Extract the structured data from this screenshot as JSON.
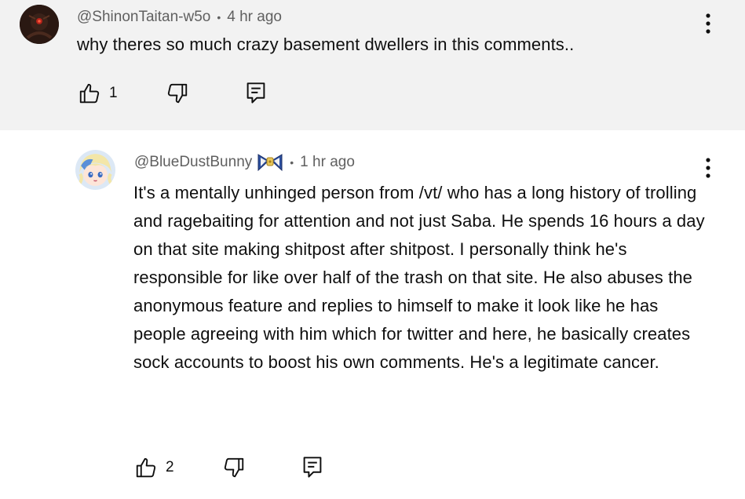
{
  "comments": [
    {
      "author": "@ShinonTaitan-w5o",
      "separator": "•",
      "time": "4 hr ago",
      "text": "why theres so much crazy basement dwellers in this comments..",
      "likes": "1",
      "avatar_icon": "dark-robot-avatar"
    },
    {
      "author": "@BlueDustBunny",
      "separator": "•",
      "time": "1 hr ago",
      "text": "It's a mentally unhinged person from /vt/ who has a long history of trolling and ragebaiting for attention and not just Saba. He spends 16 hours a day on that site making shitpost after shitpost. I personally think he's responsible for like over half of the trash on that site. He also abuses the anonymous feature and replies to himself to make it look like he has people agreeing with him which for twitter and here, he basically creates sock accounts to boost his own comments. He's a legitimate cancer.",
      "likes": "2",
      "avatar_icon": "anime-girl-avatar"
    }
  ],
  "colors": {
    "highlight_bg": "#f2f2f2",
    "meta_text": "#606060",
    "body_text": "#0f0f0f"
  }
}
